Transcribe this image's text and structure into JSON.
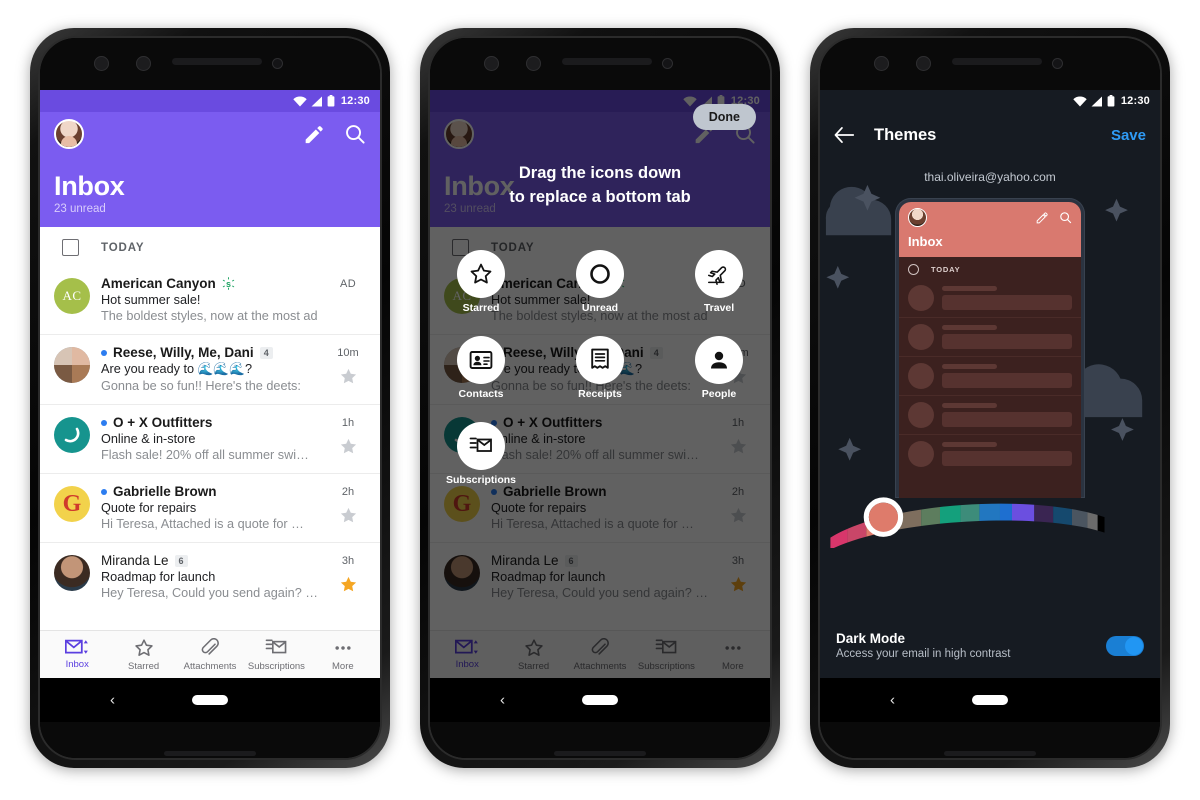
{
  "statusbar": {
    "time": "12:30",
    "wifi_icon": "wifi-icon",
    "signal_icon": "signal-icon",
    "battery_icon": "battery-icon"
  },
  "colors": {
    "purple": "#7B5CF0",
    "accent_blue": "#2f9bf5",
    "theme_salmon": "#D9796F",
    "star_active": "#F5A623",
    "dark_bg": "#161b22"
  },
  "phone1": {
    "header": {
      "title": "Inbox",
      "subtitle": "23 unread",
      "avatar": "user-avatar",
      "compose_icon": "compose-pencil-icon",
      "search_icon": "search-icon"
    },
    "list_header": {
      "label": "TODAY",
      "checkbox": "select-all-checkbox"
    },
    "emails": [
      {
        "from": "American Canyon",
        "subject": "Hot summer sale!",
        "preview": "The boldest styles, now at the most adv…",
        "time": "AD",
        "is_ad": true,
        "unread": false,
        "bold": true,
        "count": "",
        "starred": false,
        "show_star": false,
        "avatar_initials": "AC",
        "avatar_color": "#A5BF4A",
        "verified_icon": "sponsored-icon"
      },
      {
        "from": "Reese, Willy, Me, Dani",
        "subject": "Are you ready to 🌊🌊🌊?",
        "preview": "Gonna be so fun!! Here's the deets:",
        "time": "10m",
        "is_ad": false,
        "unread": true,
        "bold": true,
        "count": "4",
        "starred": false,
        "show_star": true,
        "avatar_initials": "",
        "avatar_color": "#6d7a86",
        "avatar_type": "group-avatar"
      },
      {
        "from": "O + X Outfitters",
        "subject": "Online & in-store",
        "preview": "Flash sale! 20% off all summer swi…",
        "time": "1h",
        "is_ad": false,
        "unread": true,
        "bold": true,
        "count": "",
        "starred": false,
        "show_star": true,
        "avatar_initials": "",
        "avatar_color": "#16948E",
        "avatar_type": "brand-ox"
      },
      {
        "from": "Gabrielle Brown",
        "subject": "Quote for repairs",
        "preview": "Hi Teresa, Attached is a quote for …",
        "time": "2h",
        "is_ad": false,
        "unread": true,
        "bold": true,
        "count": "",
        "starred": false,
        "show_star": true,
        "avatar_initials": "G",
        "avatar_color": "#F2D24B",
        "avatar_type": "brand-g"
      },
      {
        "from": "Miranda Le",
        "subject": "Roadmap for launch",
        "preview": "Hey Teresa, Could you send again? …",
        "time": "3h",
        "is_ad": false,
        "unread": false,
        "bold": false,
        "count": "6",
        "starred": true,
        "show_star": true,
        "avatar_initials": "",
        "avatar_color": "#4a6278",
        "avatar_type": "photo-avatar"
      }
    ],
    "tabs": [
      {
        "label": "Inbox",
        "icon": "inbox-envelope-icon",
        "active": true
      },
      {
        "label": "Starred",
        "icon": "star-icon",
        "active": false
      },
      {
        "label": "Attachments",
        "icon": "paperclip-icon",
        "active": false
      },
      {
        "label": "Subscriptions",
        "icon": "subscriptions-icon",
        "active": false
      },
      {
        "label": "More",
        "icon": "more-dots-icon",
        "active": false
      }
    ],
    "system_nav": {
      "back_icon": "back-chevron-icon",
      "home_icon": "home-pill-icon"
    }
  },
  "phone2": {
    "done_label": "Done",
    "tip_line1": "Drag the icons down",
    "tip_line2": "to replace a bottom tab",
    "bubbles": [
      {
        "label": "Starred",
        "icon": "star-icon"
      },
      {
        "label": "Unread",
        "icon": "unread-circle-icon"
      },
      {
        "label": "Travel",
        "icon": "airplane-icon"
      },
      {
        "label": "Contacts",
        "icon": "contact-card-icon"
      },
      {
        "label": "Receipts",
        "icon": "receipt-icon"
      },
      {
        "label": "People",
        "icon": "person-icon"
      },
      {
        "label": "Subscriptions",
        "icon": "subscriptions-icon"
      }
    ]
  },
  "phone3": {
    "header": {
      "title": "Themes",
      "save_label": "Save",
      "back_icon": "back-arrow-icon"
    },
    "account_email": "thai.oliveira@yahoo.com",
    "preview": {
      "title": "Inbox",
      "today_label": "TODAY",
      "compose_icon": "compose-pencil-icon",
      "search_icon": "search-icon",
      "avatar": "user-avatar"
    },
    "color_picker": {
      "name": "theme-color-slider",
      "selected_color": "#DE7B6B",
      "swatches": [
        "#D8366B",
        "#C94668",
        "#DE7B6B",
        "#7E6E5E",
        "#5D7D5E",
        "#14A07C",
        "#3D8C7A",
        "#2277C0",
        "#1E6FD0",
        "#6B4FE0",
        "#3A2552",
        "#15496E",
        "#4B5560",
        "#6B6B6B",
        "#000000"
      ]
    },
    "dark_mode": {
      "title": "Dark Mode",
      "subtitle": "Access your email in high contrast",
      "enabled": true
    },
    "decorations": [
      "moon-icon",
      "cloud-icon",
      "sparkle-icon"
    ]
  }
}
